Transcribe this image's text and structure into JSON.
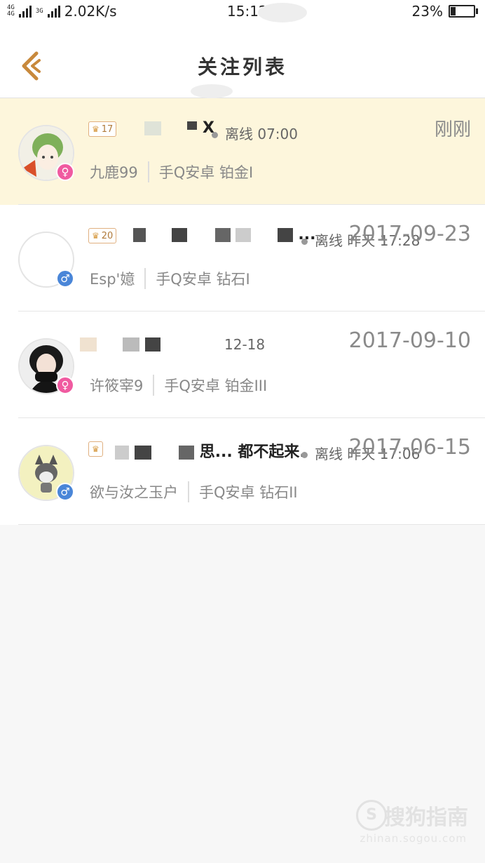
{
  "status_bar": {
    "network_a": "4G",
    "network_b": "4G",
    "network_c": "3G",
    "speed": "2.02K/s",
    "time": "15:12",
    "battery": "23%",
    "battery_level": 0.23
  },
  "header": {
    "title": "关注列表",
    "back_icon": "back-chevron-icon",
    "accent": "#c8893c"
  },
  "follows": [
    {
      "level": "17",
      "nick": "X",
      "status": "离线 07:00",
      "time": "刚刚",
      "name": "九鹿99",
      "platform": "手Q安卓 铂金I",
      "gender": "♀",
      "gender_type": "f",
      "highlighted": true
    },
    {
      "level": "20",
      "nick": "...",
      "status": "离线 昨天 17:28",
      "time": "2017-09-23",
      "name": "Esp'嬑",
      "platform": "手Q安卓 钻石I",
      "gender": "♂",
      "gender_type": "m",
      "highlighted": false
    },
    {
      "level": "",
      "nick": "",
      "status": "12-18",
      "time": "2017-09-10",
      "name": "许筱宰9",
      "platform": "手Q安卓 铂金III",
      "gender": "♀",
      "gender_type": "f",
      "highlighted": false
    },
    {
      "level": "",
      "nick": "思... 都不起来.",
      "status": "离线 昨天 17:06",
      "time": "2017-06-15",
      "name": "欲与汝之玉户",
      "platform": "手Q安卓 钻石II",
      "gender": "♂",
      "gender_type": "m",
      "highlighted": false
    }
  ],
  "watermark": {
    "logo_icon": "sogou-s-icon",
    "text": "搜狗指南",
    "url": "zhinan.sogou.com"
  }
}
